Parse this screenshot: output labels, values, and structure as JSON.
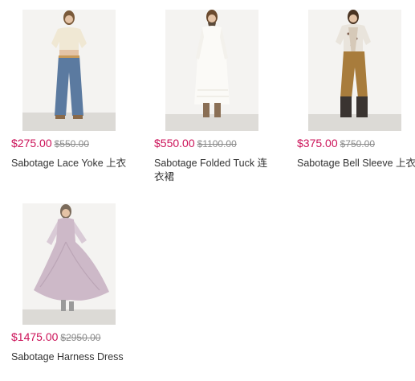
{
  "products": [
    {
      "price": "$275.00",
      "old_price": "$550.00",
      "title": "Sabotage Lace Yoke 上衣",
      "image_icon": "woman-cream-blouse-denim-flares-photo"
    },
    {
      "price": "$550.00",
      "old_price": "$1100.00",
      "title": "Sabotage Folded Tuck 连衣裙",
      "image_icon": "woman-white-maxi-dress-photo"
    },
    {
      "price": "$375.00",
      "old_price": "$750.00",
      "title": "Sabotage Bell Sleeve 上衣",
      "image_icon": "woman-print-blouse-tan-pants-photo"
    },
    {
      "price": "$1475.00",
      "old_price": "$2950.00",
      "title": "Sabotage Harness Dress",
      "image_icon": "woman-lilac-chiffon-gown-photo"
    }
  ],
  "colors": {
    "sale_price": "#cc1359",
    "original_price": "#8c8c8c",
    "title_text": "#333333"
  }
}
